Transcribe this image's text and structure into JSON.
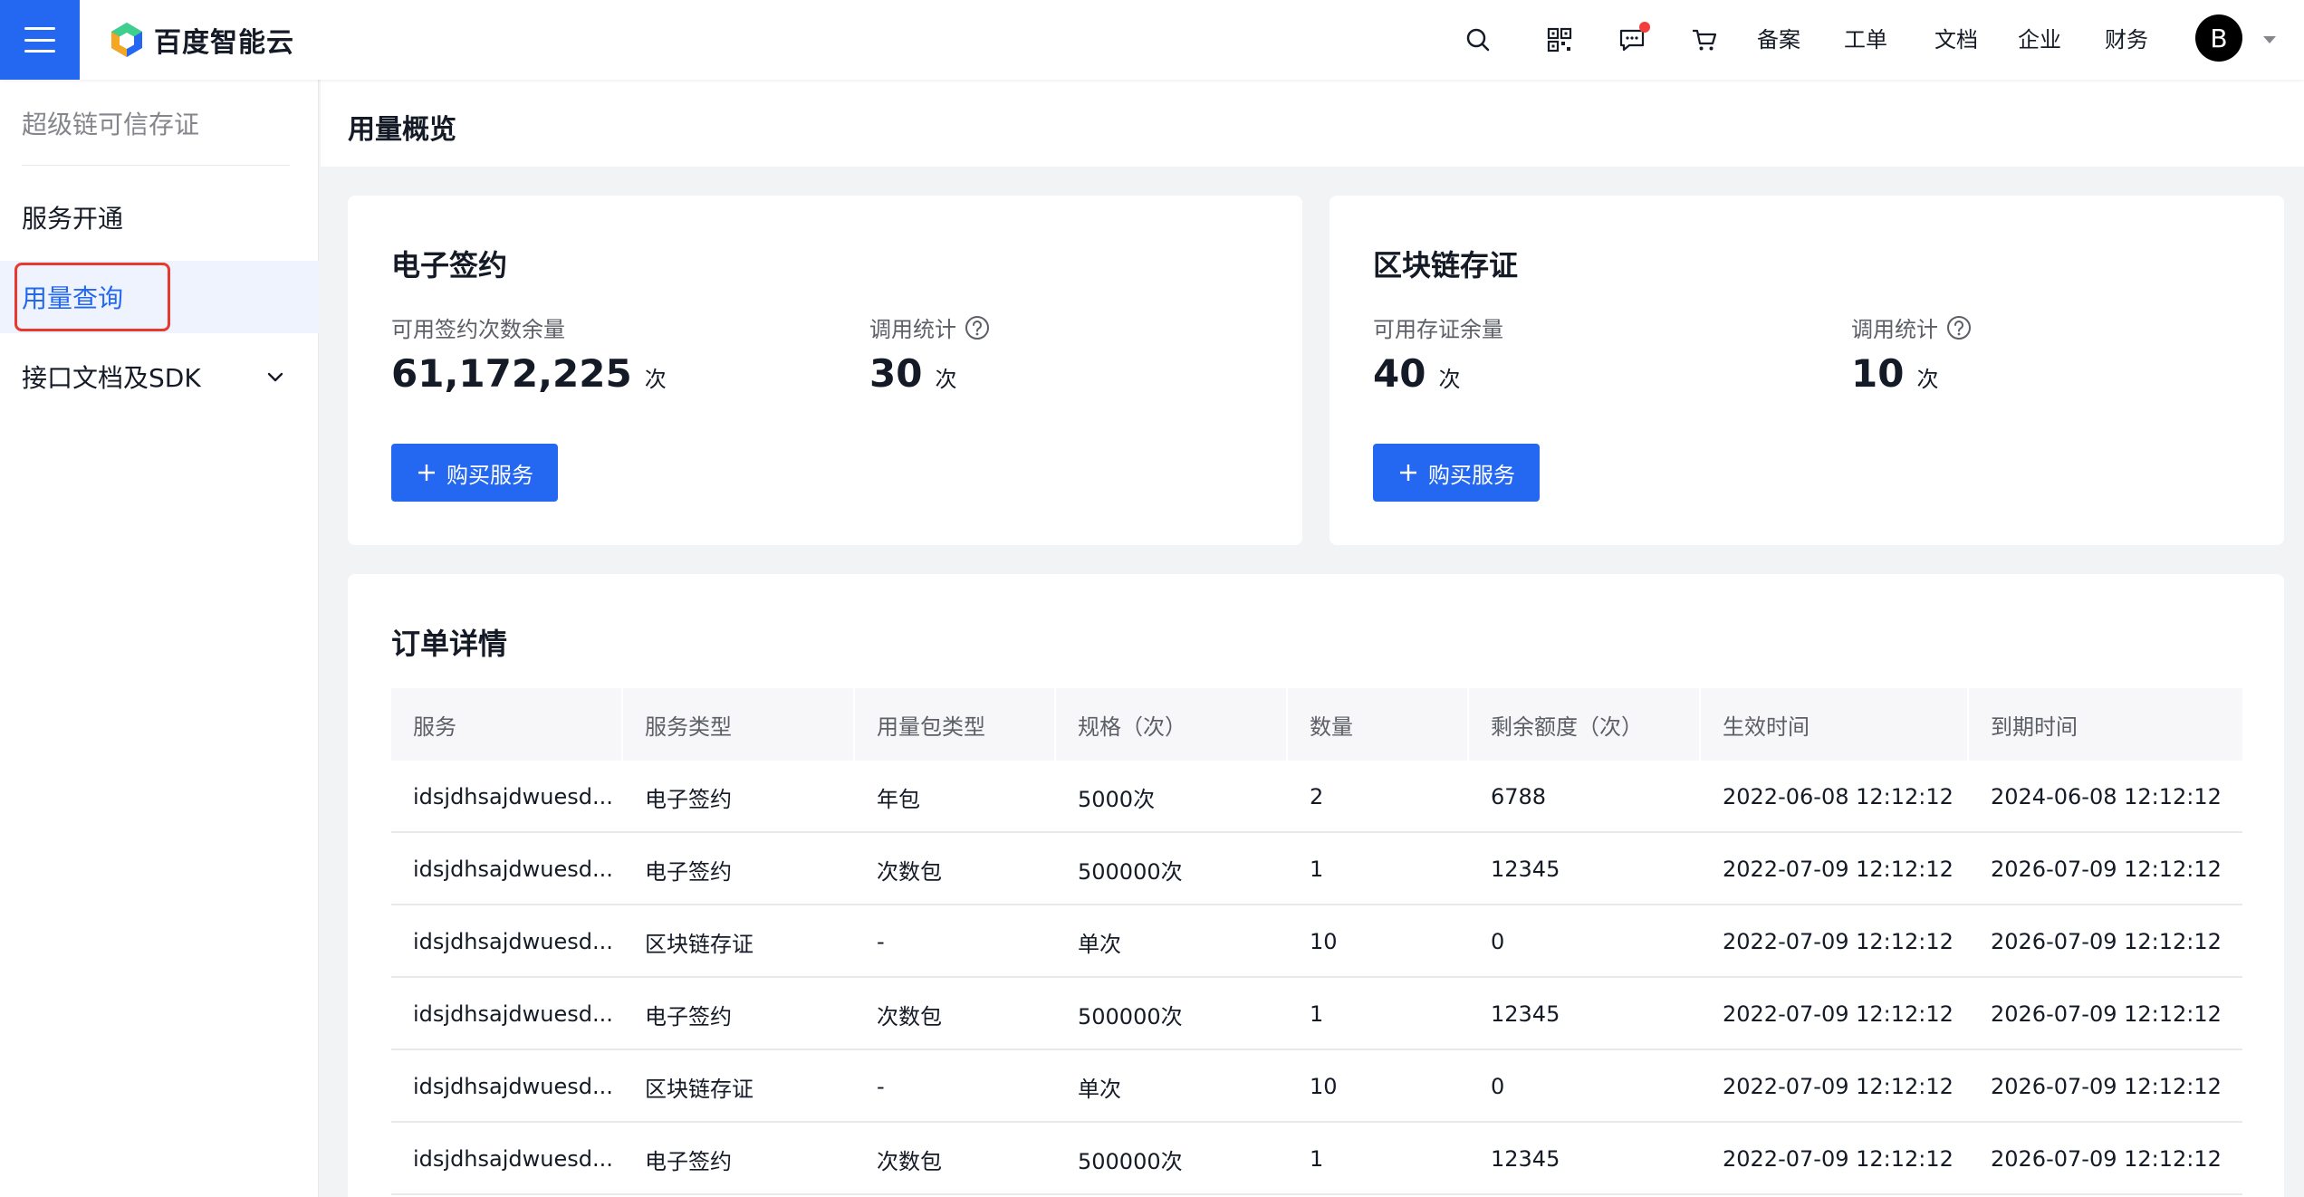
{
  "brand": {
    "name": "百度智能云"
  },
  "topbar": {
    "icons": [
      "search-icon",
      "qrcode-icon",
      "message-icon",
      "cart-icon"
    ],
    "links": [
      "备案",
      "工单",
      "文档",
      "企业",
      "财务"
    ],
    "avatar_letter": "B"
  },
  "sidebar": {
    "title": "超级链可信存证",
    "items": [
      {
        "label": "服务开通",
        "active": false
      },
      {
        "label": "用量查询",
        "active": true
      },
      {
        "label": "接口文档及SDK",
        "active": false,
        "expandable": true
      }
    ]
  },
  "page": {
    "title": "用量概览"
  },
  "cards": [
    {
      "title": "电子签约",
      "stats": [
        {
          "label": "可用签约次数余量",
          "value": "61,172,225",
          "unit": "次",
          "help": false
        },
        {
          "label": "调用统计",
          "value": "30",
          "unit": "次",
          "help": true
        }
      ],
      "button": "购买服务"
    },
    {
      "title": "区块链存证",
      "stats": [
        {
          "label": "可用存证余量",
          "value": "40",
          "unit": "次",
          "help": false
        },
        {
          "label": "调用统计",
          "value": "10",
          "unit": "次",
          "help": true
        }
      ],
      "button": "购买服务"
    }
  ],
  "orders": {
    "title": "订单详情",
    "columns": [
      "服务",
      "服务类型",
      "用量包类型",
      "规格（次）",
      "数量",
      "剩余额度（次）",
      "生效时间",
      "到期时间"
    ],
    "rows": [
      [
        "idsjdhsajdwuesd...",
        "电子签约",
        "年包",
        "5000次",
        "2",
        "6788",
        "2022-06-08 12:12:12",
        "2024-06-08 12:12:12"
      ],
      [
        "idsjdhsajdwuesd...",
        "电子签约",
        "次数包",
        "500000次",
        "1",
        "12345",
        "2022-07-09 12:12:12",
        "2026-07-09 12:12:12"
      ],
      [
        "idsjdhsajdwuesd...",
        "区块链存证",
        "-",
        "单次",
        "10",
        "0",
        "2022-07-09 12:12:12",
        "2026-07-09 12:12:12"
      ],
      [
        "idsjdhsajdwuesd...",
        "电子签约",
        "次数包",
        "500000次",
        "1",
        "12345",
        "2022-07-09 12:12:12",
        "2026-07-09 12:12:12"
      ],
      [
        "idsjdhsajdwuesd...",
        "区块链存证",
        "-",
        "单次",
        "10",
        "0",
        "2022-07-09 12:12:12",
        "2026-07-09 12:12:12"
      ],
      [
        "idsjdhsajdwuesd...",
        "电子签约",
        "次数包",
        "500000次",
        "1",
        "12345",
        "2022-07-09 12:12:12",
        "2026-07-09 12:12:12"
      ]
    ]
  },
  "colors": {
    "primary": "#2468f2",
    "highlight": "#e8392e",
    "notification": "#f33e3e"
  }
}
